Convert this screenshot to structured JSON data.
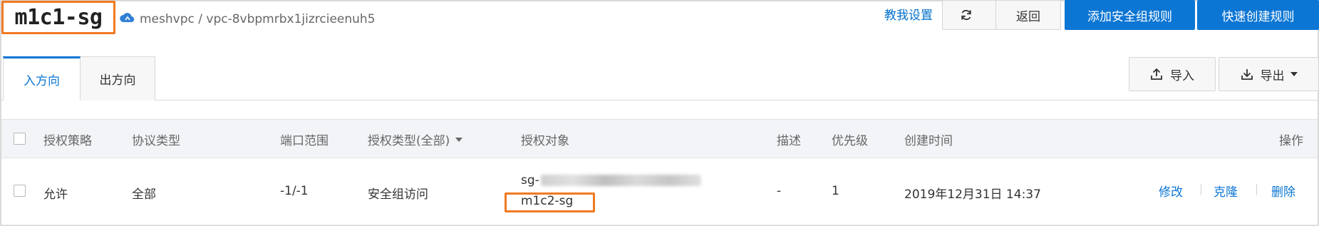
{
  "header": {
    "title": "m1c1-sg",
    "vpc_path": "meshvpc / vpc-8vbpmrbx1jizrcieenuh5",
    "teach_link": "教我设置",
    "back_label": "返回",
    "add_rule_label": "添加安全组规则",
    "quick_create_label": "快速创建规则"
  },
  "tabs": [
    {
      "label": "入方向",
      "active": true
    },
    {
      "label": "出方向",
      "active": false
    }
  ],
  "toolbar": {
    "import_label": "导入",
    "export_label": "导出"
  },
  "table": {
    "columns": {
      "policy": "授权策略",
      "protocol": "协议类型",
      "port": "端口范围",
      "auth_type": "授权类型(全部)",
      "auth_object": "授权对象",
      "desc": "描述",
      "priority": "优先级",
      "created": "创建时间",
      "ops": "操作"
    },
    "rows": [
      {
        "policy": "允许",
        "protocol": "全部",
        "port": "-1/-1",
        "auth_type": "安全组访问",
        "auth_object_prefix": "sg-",
        "auth_object_name": "m1c2-sg",
        "desc": "-",
        "priority": "1",
        "created": "2019年12月31日 14:37",
        "actions": {
          "edit": "修改",
          "clone": "克隆",
          "delete": "删除"
        }
      }
    ]
  },
  "colors": {
    "primary": "#0c76d4",
    "highlight": "#f07a21",
    "link": "#0070cc"
  }
}
